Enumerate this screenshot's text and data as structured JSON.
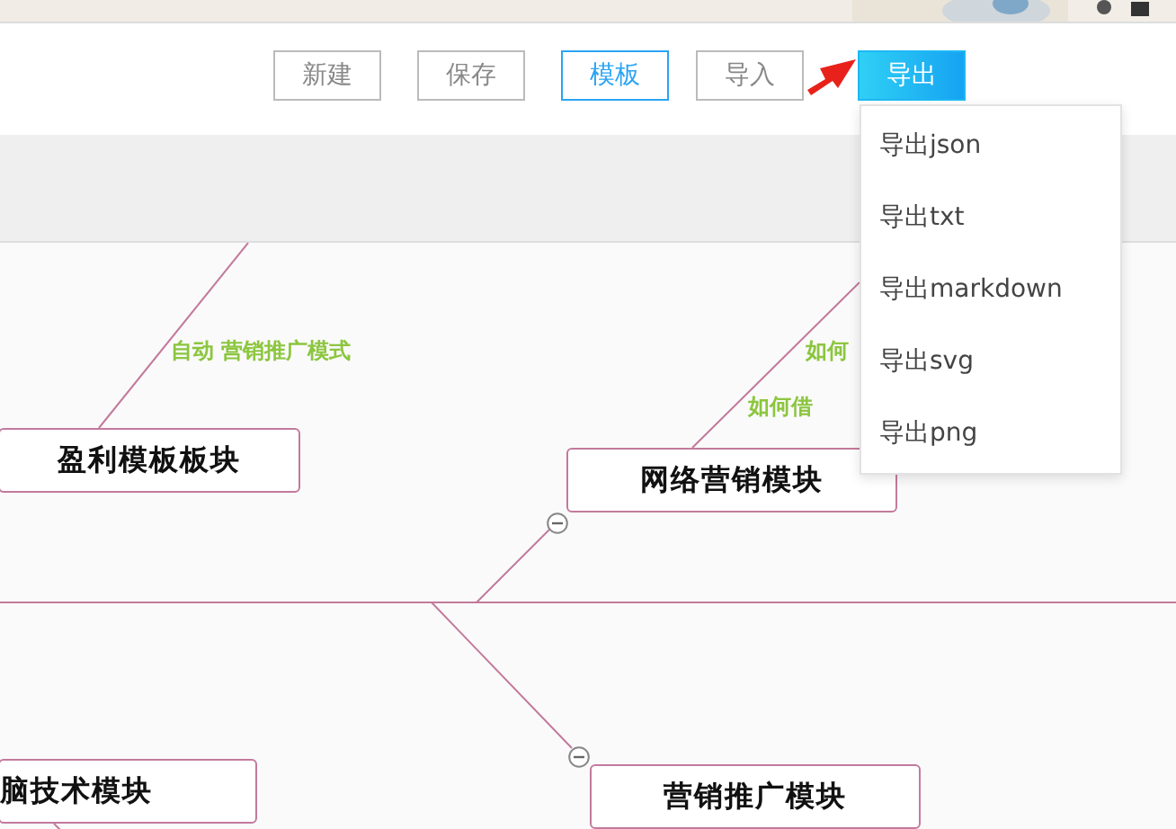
{
  "toolbar": {
    "buttons": [
      {
        "label": "新建",
        "kind": "default"
      },
      {
        "label": "保存",
        "kind": "default"
      },
      {
        "label": "模板",
        "kind": "highlight"
      },
      {
        "label": "导入",
        "kind": "default"
      },
      {
        "label": "导出",
        "kind": "primary"
      }
    ]
  },
  "export_menu": {
    "items": [
      "导出json",
      "导出txt",
      "导出markdown",
      "导出svg",
      "导出png"
    ]
  },
  "mind_map": {
    "nodes": [
      {
        "text": "盈利模板板块",
        "collapse_handle": false
      },
      {
        "text": "网络营销模块",
        "collapse_handle": true
      },
      {
        "text": "脑技术模块",
        "collapse_handle": false
      },
      {
        "text": "营销推广模块",
        "collapse_handle": true
      }
    ],
    "topics": [
      "自动 营销推广模式",
      "如何",
      "如何借"
    ]
  }
}
